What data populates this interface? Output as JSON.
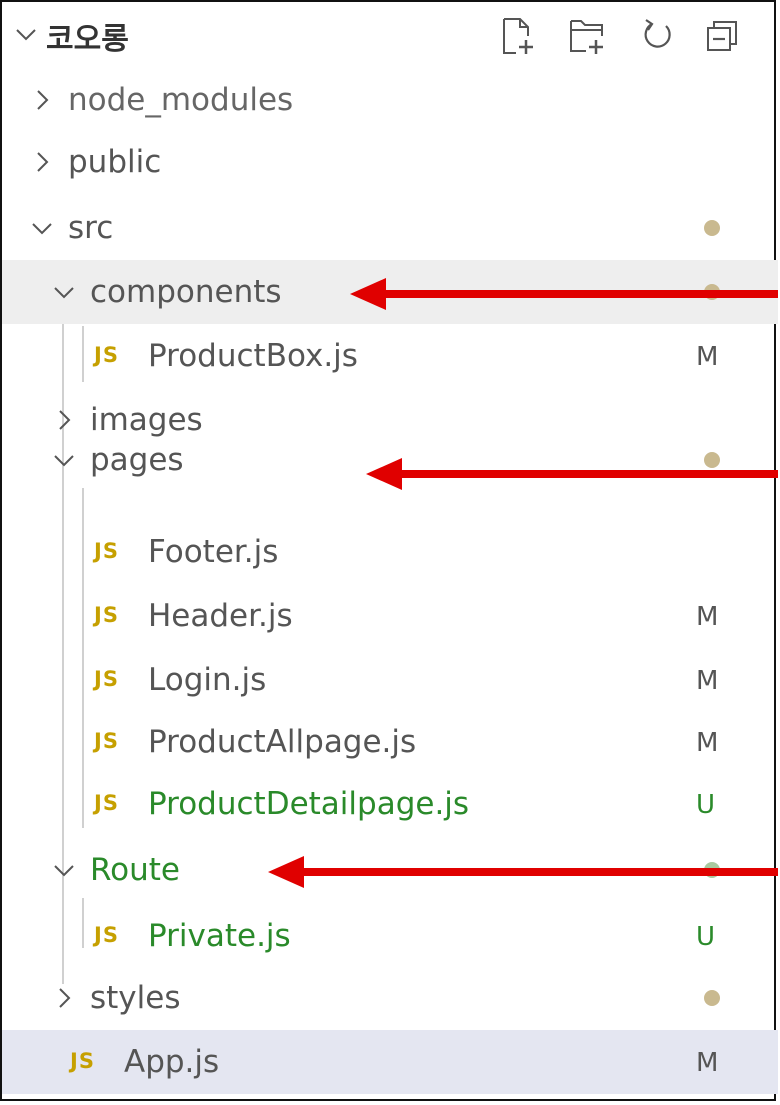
{
  "explorer": {
    "title": "코오롱",
    "actions": {
      "new_file_icon": "new-file-icon",
      "new_folder_icon": "new-folder-icon",
      "refresh_icon": "refresh-icon",
      "collapse_icon": "collapse-all-icon"
    }
  },
  "tree": [
    {
      "label": "node_modules",
      "kind": "folder",
      "open": false,
      "depth": 0
    },
    {
      "label": "public",
      "kind": "folder",
      "open": false,
      "depth": 0
    },
    {
      "label": "src",
      "kind": "folder",
      "open": true,
      "depth": 0,
      "status": "dot"
    },
    {
      "label": "components",
      "kind": "folder",
      "open": true,
      "depth": 1,
      "status": "dot"
    },
    {
      "label": "ProductBox.js",
      "kind": "file",
      "depth": 2,
      "status": "M"
    },
    {
      "label": "images",
      "kind": "folder",
      "open": false,
      "depth": 1
    },
    {
      "label": "pages",
      "kind": "folder",
      "open": true,
      "depth": 1,
      "status": "dot"
    },
    {
      "label": "Footer.js",
      "kind": "file",
      "depth": 2
    },
    {
      "label": "Header.js",
      "kind": "file",
      "depth": 2,
      "status": "M"
    },
    {
      "label": "Login.js",
      "kind": "file",
      "depth": 2,
      "status": "M"
    },
    {
      "label": "ProductAllpage.js",
      "kind": "file",
      "depth": 2,
      "status": "M"
    },
    {
      "label": "ProductDetailpage.js",
      "kind": "file",
      "depth": 2,
      "status": "U"
    },
    {
      "label": "Route",
      "kind": "folder",
      "open": true,
      "depth": 1,
      "status": "dot-green"
    },
    {
      "label": "Private.js",
      "kind": "file",
      "depth": 2,
      "status": "U"
    },
    {
      "label": "styles",
      "kind": "folder",
      "open": false,
      "depth": 1,
      "status": "dot"
    },
    {
      "label": "App.js",
      "kind": "file",
      "depth": 1,
      "status": "M"
    }
  ],
  "file_icon_text": "JS",
  "colors": {
    "untracked": "#2a8a2a",
    "js_icon": "#c6a000",
    "modified_dot": "#c9b98f",
    "arrow": "#e00000",
    "selected_bg": "#e4e6f1",
    "hover_bg": "#eeeeee"
  }
}
